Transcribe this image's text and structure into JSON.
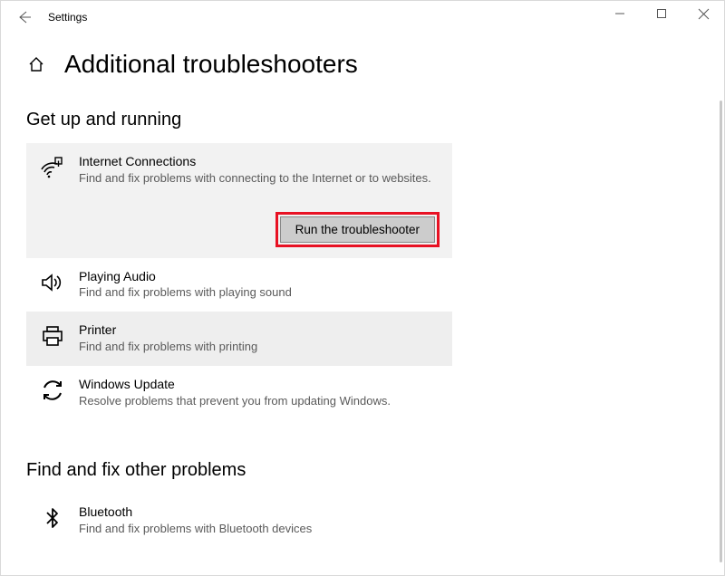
{
  "window": {
    "title": "Settings"
  },
  "page": {
    "heading": "Additional troubleshooters"
  },
  "sections": {
    "getup": {
      "title": "Get up and running",
      "items": [
        {
          "name": "Internet Connections",
          "desc": "Find and fix problems with connecting to the Internet or to websites."
        },
        {
          "name": "Playing Audio",
          "desc": "Find and fix problems with playing sound"
        },
        {
          "name": "Printer",
          "desc": "Find and fix problems with printing"
        },
        {
          "name": "Windows Update",
          "desc": "Resolve problems that prevent you from updating Windows."
        }
      ]
    },
    "other": {
      "title": "Find and fix other problems",
      "items": [
        {
          "name": "Bluetooth",
          "desc": "Find and fix problems with Bluetooth devices"
        }
      ]
    }
  },
  "buttons": {
    "run": "Run the troubleshooter"
  }
}
